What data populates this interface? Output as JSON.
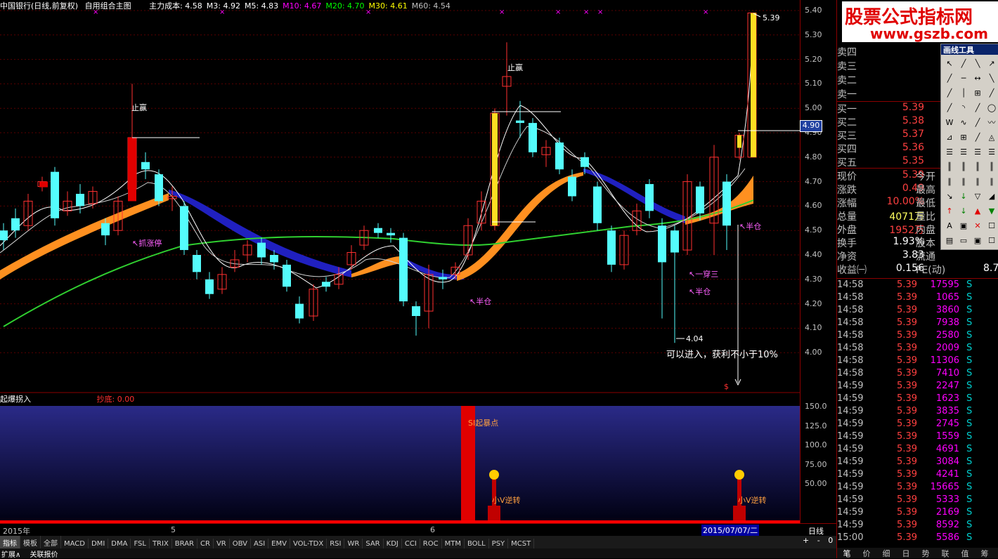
{
  "header": {
    "stock": "中国银行(日线,前复权)",
    "formula": "自用组合主图",
    "items": [
      {
        "label": "主力成本: 4.58",
        "color": "#ffffff"
      },
      {
        "label": "M3: 4.92",
        "color": "#ffffff"
      },
      {
        "label": "M5: 4.83",
        "color": "#ffffff"
      },
      {
        "label": "M10: 4.67",
        "color": "#ff00ff"
      },
      {
        "label": "M20: 4.70",
        "color": "#00ff00"
      },
      {
        "label": "M30: 4.61",
        "color": "#ffff00"
      },
      {
        "label": "M60: 4.54",
        "color": "#c0c0c0"
      }
    ]
  },
  "yaxis_main": [
    "5.40",
    "5.30",
    "5.20",
    "5.10",
    "5.00",
    "4.90",
    "4.80",
    "4.70",
    "4.60",
    "4.50",
    "4.40",
    "4.30",
    "4.20",
    "4.10",
    "4.00"
  ],
  "price_marker": "4.90",
  "annotations": {
    "top_left_stop": "止赢",
    "top_mid_stop": "止赢",
    "catch_limit": "↖抓涨停",
    "half1": "↖半仓",
    "half2": "↖半仓",
    "half3": "↖半仓",
    "one_through": "↖一穿三",
    "low_label": "4.04",
    "high_label": "5.39",
    "entry_note": "可以进入，获利不小于10%",
    "dollar": "$"
  },
  "indicator": {
    "name": "起爆拐入",
    "value_label": "抄底: 0.00",
    "yticks": [
      "150.0",
      "125.0",
      "100.0",
      "75.00",
      "50.00"
    ],
    "si_label": "SI起暴点",
    "v1_label": "小V逆转",
    "v2_label": "小V逆转"
  },
  "date_axis": {
    "year": "2015年",
    "m5": "5",
    "m6": "6",
    "current": "2015/07/07/二",
    "period": "日线"
  },
  "tabs": [
    "指标",
    "模板",
    "全部",
    "MACD",
    "DMI",
    "DMA",
    "FSL",
    "TRIX",
    "BRAR",
    "CR",
    "VR",
    "OBV",
    "ASI",
    "EMV",
    "VOL-TDX",
    "RSI",
    "WR",
    "SAR",
    "KDJ",
    "CCI",
    "ROC",
    "MTM",
    "BOLL",
    "PSY",
    "MCST"
  ],
  "tab_controls": [
    "+",
    "-",
    "0"
  ],
  "bottom_bar": [
    "扩展∧",
    "关联报价"
  ],
  "watermark": {
    "title": "股票公式指标网",
    "url": "www.gszb.com"
  },
  "toolbox_title": "画线工具",
  "order_book": {
    "sells": [
      {
        "label": "卖四"
      },
      {
        "label": "卖三"
      },
      {
        "label": "卖二"
      },
      {
        "label": "卖一"
      }
    ],
    "buys": [
      {
        "label": "买一",
        "price": "5.39"
      },
      {
        "label": "买二",
        "price": "5.38"
      },
      {
        "label": "买三",
        "price": "5.37"
      },
      {
        "label": "买四",
        "price": "5.36"
      },
      {
        "label": "买五",
        "price": "5.35"
      }
    ]
  },
  "stats": [
    {
      "label": "现价",
      "value": "5.39",
      "extra": "今开"
    },
    {
      "label": "涨跌",
      "value": "0.49",
      "extra": "最高"
    },
    {
      "label": "涨幅",
      "value": "10.00%",
      "extra": "最低"
    },
    {
      "label": "总量",
      "value": "4071万",
      "extra": "量比"
    },
    {
      "label": "外盘",
      "value": "1952万",
      "extra": "内盘"
    },
    {
      "label": "换手",
      "value": "1.93%",
      "extra": "股本"
    },
    {
      "label": "净资",
      "value": "3.83",
      "extra": "流通"
    },
    {
      "label": "收益㈠",
      "value": "0.156",
      "extra": "PE(动)",
      "extra_val": "8.7"
    }
  ],
  "ticks": [
    {
      "t": "14:58",
      "p": "5.39",
      "v": "17595",
      "s": "S"
    },
    {
      "t": "14:58",
      "p": "5.39",
      "v": "1065",
      "s": "S"
    },
    {
      "t": "14:58",
      "p": "5.39",
      "v": "3860",
      "s": "S"
    },
    {
      "t": "14:58",
      "p": "5.39",
      "v": "7938",
      "s": "S"
    },
    {
      "t": "14:58",
      "p": "5.39",
      "v": "2580",
      "s": "S"
    },
    {
      "t": "14:58",
      "p": "5.39",
      "v": "2009",
      "s": "S"
    },
    {
      "t": "14:58",
      "p": "5.39",
      "v": "11306",
      "s": "S"
    },
    {
      "t": "14:58",
      "p": "5.39",
      "v": "7410",
      "s": "S"
    },
    {
      "t": "14:59",
      "p": "5.39",
      "v": "2247",
      "s": "S"
    },
    {
      "t": "14:59",
      "p": "5.39",
      "v": "1623",
      "s": "S"
    },
    {
      "t": "14:59",
      "p": "5.39",
      "v": "3835",
      "s": "S"
    },
    {
      "t": "14:59",
      "p": "5.39",
      "v": "2745",
      "s": "S"
    },
    {
      "t": "14:59",
      "p": "5.39",
      "v": "1559",
      "s": "S"
    },
    {
      "t": "14:59",
      "p": "5.39",
      "v": "4691",
      "s": "S"
    },
    {
      "t": "14:59",
      "p": "5.39",
      "v": "3084",
      "s": "S"
    },
    {
      "t": "14:59",
      "p": "5.39",
      "v": "4241",
      "s": "S"
    },
    {
      "t": "14:59",
      "p": "5.39",
      "v": "15665",
      "s": "S"
    },
    {
      "t": "14:59",
      "p": "5.39",
      "v": "5333",
      "s": "S"
    },
    {
      "t": "14:59",
      "p": "5.39",
      "v": "2169",
      "s": "S"
    },
    {
      "t": "14:59",
      "p": "5.39",
      "v": "8592",
      "s": "S"
    },
    {
      "t": "15:00",
      "p": "5.39",
      "v": "5586",
      "s": "S"
    }
  ],
  "right_tabs": [
    "笔",
    "价",
    "细",
    "日",
    "势",
    "联",
    "值",
    "筹"
  ],
  "colors": {
    "up": "#ff3030",
    "down": "#54fcfc",
    "ma_green": "#30d030",
    "band_orange": "#ff9020",
    "band_blue": "#2020c0"
  }
}
